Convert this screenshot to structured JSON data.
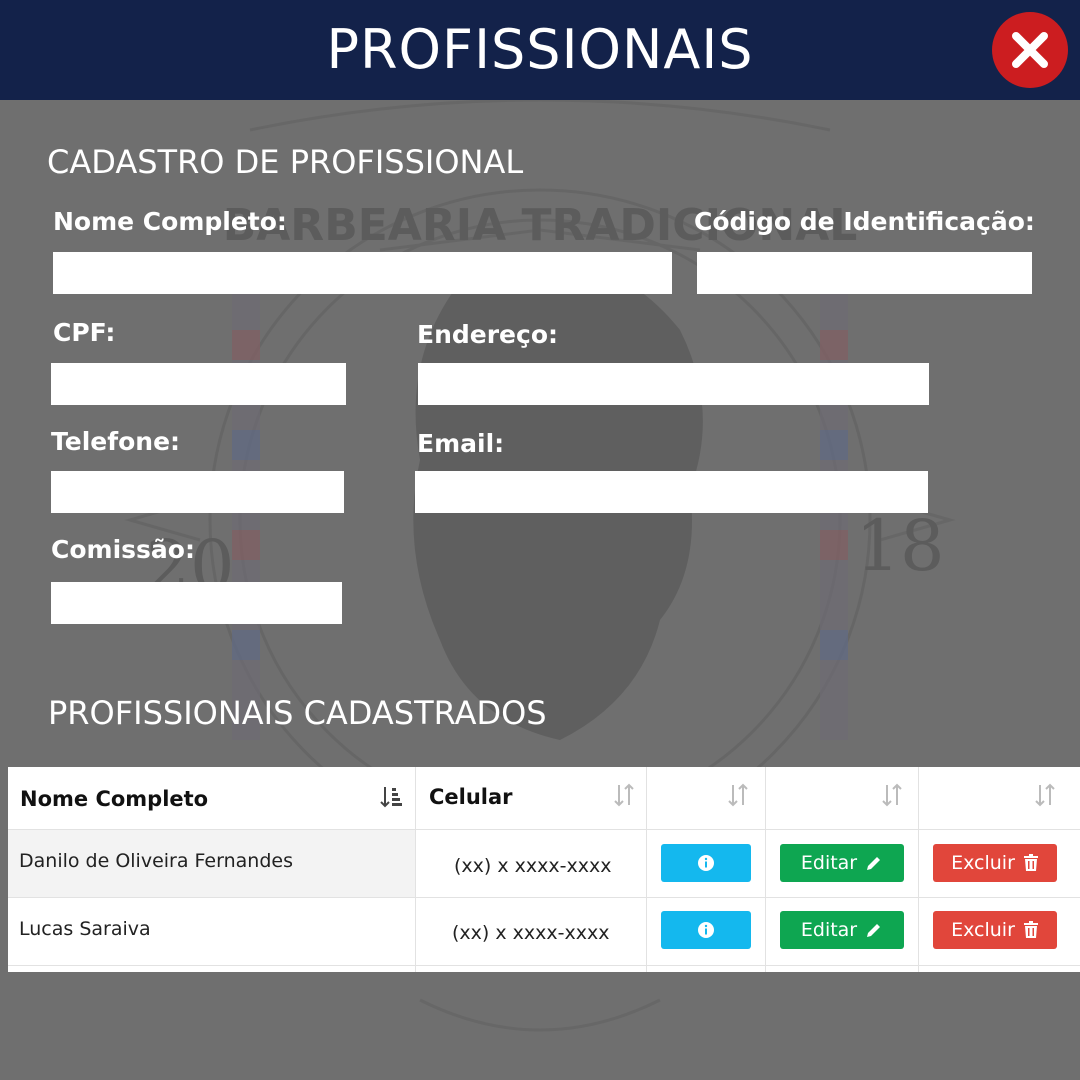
{
  "header": {
    "title": "PROFISSIONAIS"
  },
  "form": {
    "title": "CADASTRO DE PROFISSIONAL",
    "fields": {
      "nome": {
        "label": "Nome Completo:",
        "value": ""
      },
      "codigo": {
        "label": "Código de Identificação:",
        "value": ""
      },
      "cpf": {
        "label": "CPF:",
        "value": ""
      },
      "endereco": {
        "label": "Endereço:",
        "value": ""
      },
      "telefone": {
        "label": "Telefone:",
        "value": ""
      },
      "email": {
        "label": "Email:",
        "value": ""
      },
      "comissao": {
        "label": "Comissão:",
        "value": ""
      }
    }
  },
  "list": {
    "title": "PROFISSIONAIS CADASTRADOS",
    "columns": [
      "Nome Completo",
      "Celular",
      "",
      "",
      ""
    ],
    "rows": [
      {
        "nome": "Danilo de Oliveira Fernandes",
        "celular": "(xx) x xxxx-xxxx"
      },
      {
        "nome": "Lucas Saraiva",
        "celular": "(xx) x xxxx-xxxx"
      }
    ],
    "actions": {
      "edit_label": "Editar",
      "delete_label": "Excluir"
    }
  },
  "watermark": {
    "brand": "BARBEARIA TRADICIONAL",
    "year_left": "20",
    "year_right": "18"
  },
  "icons": {
    "close": "close-icon",
    "sort": "sort-icon",
    "info": "info-icon",
    "edit": "pencil-icon",
    "delete": "trash-icon"
  },
  "colors": {
    "header_bg": "#13224a",
    "page_bg": "#6f6f6f",
    "close_bg": "#cc1d20",
    "info_btn": "#14b8ee",
    "edit_btn": "#0ea651",
    "delete_btn": "#e1463b"
  }
}
